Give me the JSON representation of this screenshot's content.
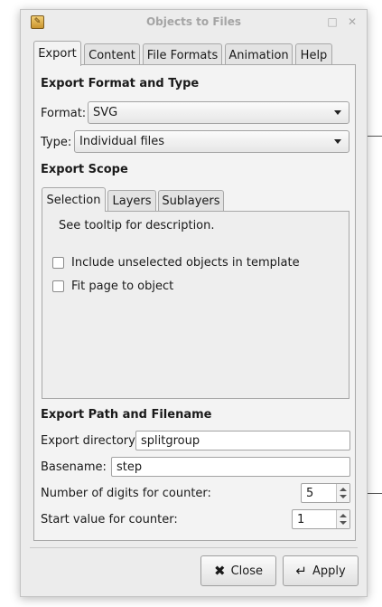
{
  "window": {
    "title": "Objects to Files",
    "icon": "inkscape-extension-icon",
    "maximize_glyph": "□",
    "close_glyph": "✕"
  },
  "tabs": [
    {
      "label": "Export",
      "active": true
    },
    {
      "label": "Content",
      "active": false
    },
    {
      "label": "File Formats",
      "active": false
    },
    {
      "label": "Animation",
      "active": false
    },
    {
      "label": "Help",
      "active": false
    }
  ],
  "export_format": {
    "heading": "Export Format and Type",
    "format_label": "Format:",
    "format_value": "SVG",
    "type_label": "Type:",
    "type_value": "Individual files"
  },
  "export_scope": {
    "heading": "Export Scope",
    "subtabs": [
      {
        "label": "Selection",
        "active": true
      },
      {
        "label": "Layers",
        "active": false
      },
      {
        "label": "Sublayers",
        "active": false
      }
    ],
    "tooltip_text": "See tooltip for description.",
    "checkboxes": [
      {
        "label": "Include unselected objects in template",
        "checked": false
      },
      {
        "label": "Fit page to object",
        "checked": false
      }
    ]
  },
  "export_path": {
    "heading": "Export Path and Filename",
    "directory_label": "Export directory:",
    "directory_value": "splitgroup",
    "basename_label": "Basename:",
    "basename_value": "step",
    "digits_label": "Number of digits for counter:",
    "digits_value": "5",
    "start_label": "Start value for counter:",
    "start_value": "1"
  },
  "buttons": {
    "close_label": "Close",
    "close_icon": "✖",
    "apply_label": "Apply",
    "apply_icon": "↵"
  },
  "colors": {
    "window_bg": "#ececec",
    "panel_bg": "#f3f3f3",
    "title_text": "#a4a4a4"
  }
}
